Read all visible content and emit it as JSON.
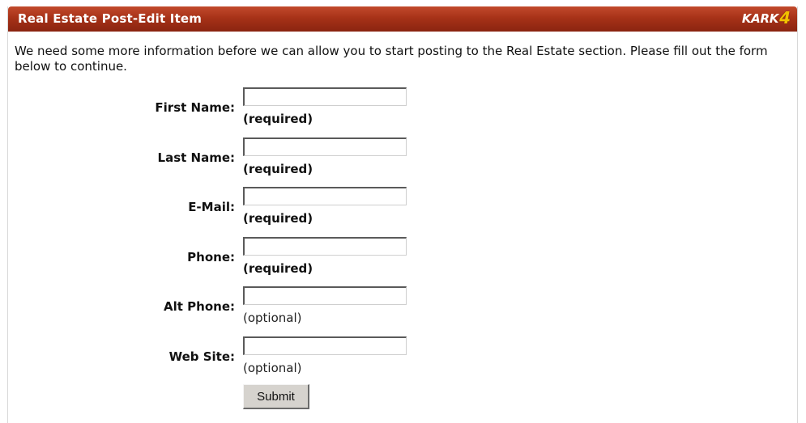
{
  "header": {
    "title": "Real Estate Post-Edit Item",
    "logo_text": "KARK",
    "logo_number": "4"
  },
  "intro": "We need some more information before we can allow you to start posting to the Real Estate section. Please fill out the form below to continue.",
  "form": {
    "fields": [
      {
        "label": "First Name:",
        "value": "",
        "note": "(required)"
      },
      {
        "label": "Last Name:",
        "value": "",
        "note": "(required)"
      },
      {
        "label": "E-Mail:",
        "value": "",
        "note": "(required)"
      },
      {
        "label": "Phone:",
        "value": "",
        "note": "(required)"
      },
      {
        "label": "Alt Phone:",
        "value": "",
        "note": "(optional)"
      },
      {
        "label": "Web Site:",
        "value": "",
        "note": "(optional)"
      }
    ],
    "submit_label": "Submit"
  },
  "colors": {
    "titlebar": "#a73218",
    "logo_accent": "#f2c200",
    "button_face": "#d6d3ce"
  }
}
